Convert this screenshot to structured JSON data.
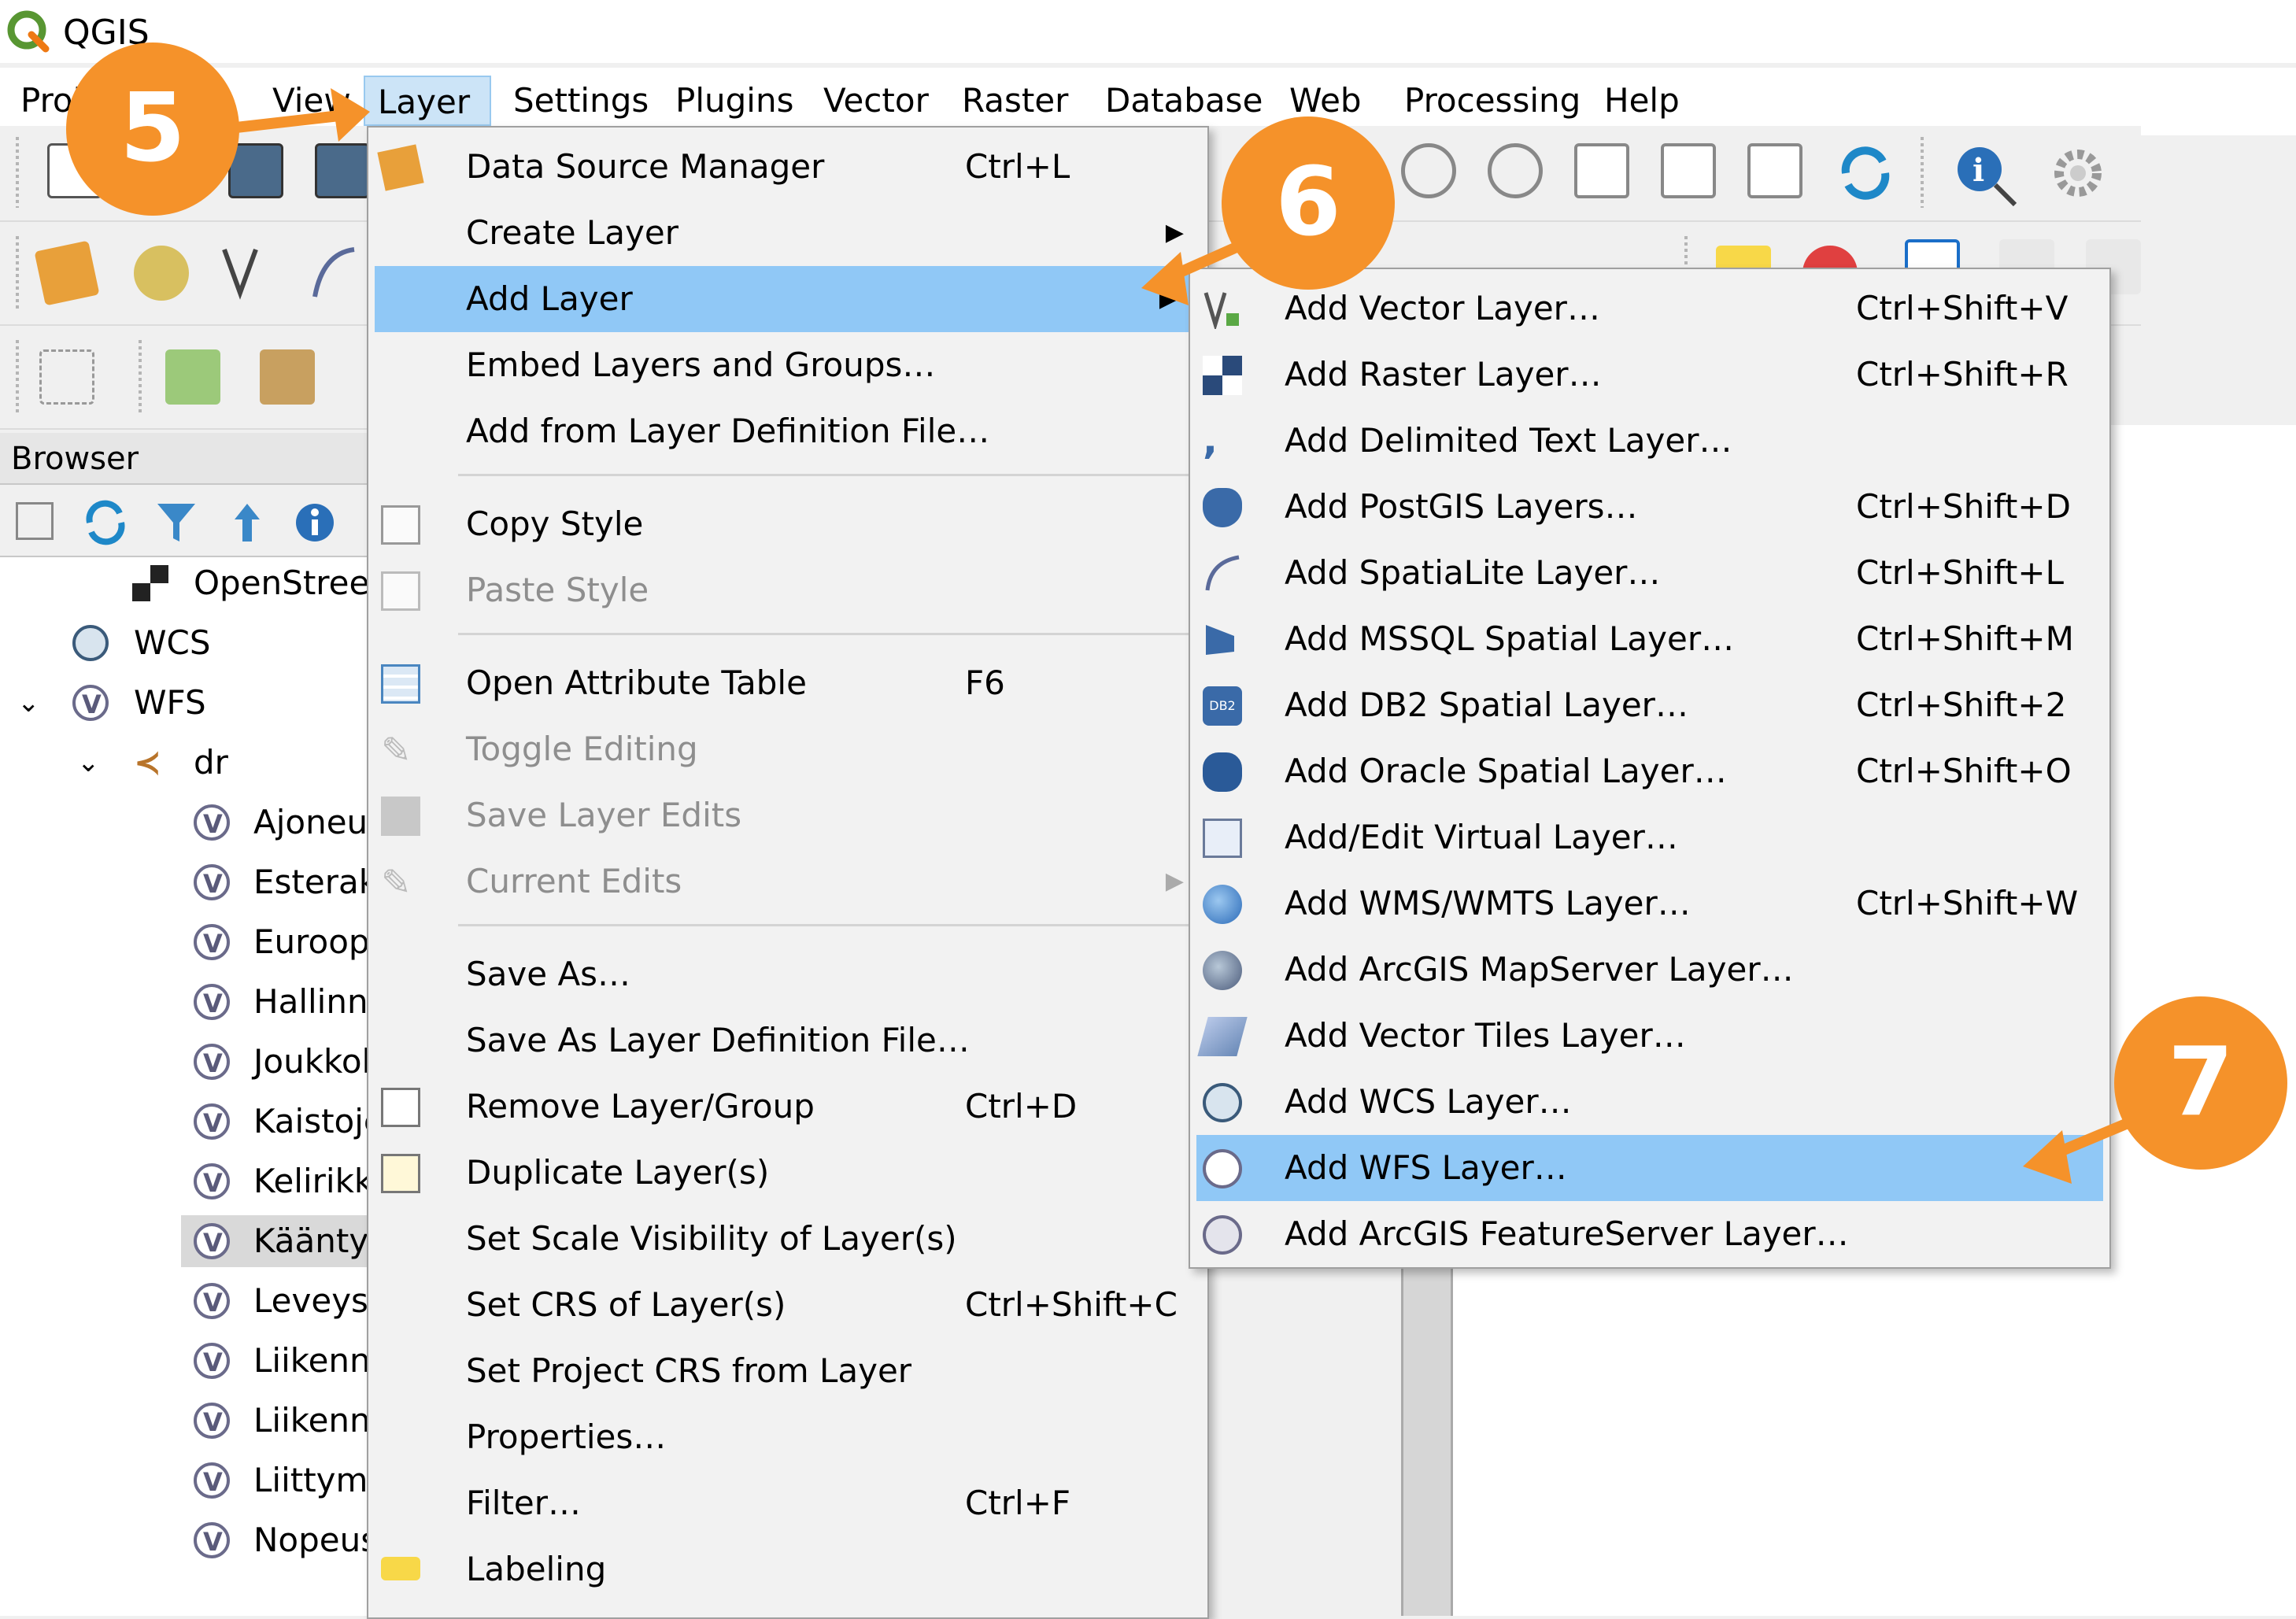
{
  "app": {
    "title": "QGIS"
  },
  "menubar": [
    {
      "label": "Proj"
    },
    {
      "label": "View"
    },
    {
      "label": "Layer"
    },
    {
      "label": "Settings"
    },
    {
      "label": "Plugins"
    },
    {
      "label": "Vector"
    },
    {
      "label": "Raster"
    },
    {
      "label": "Database"
    },
    {
      "label": "Web"
    },
    {
      "label": "Processing"
    },
    {
      "label": "Help"
    }
  ],
  "browser": {
    "title": "Browser",
    "items": [
      {
        "label": "OpenStreet"
      },
      {
        "label": "WCS"
      },
      {
        "label": "WFS"
      },
      {
        "label": "dr"
      },
      {
        "label": "Ajoneuv"
      },
      {
        "label": "Esterak"
      },
      {
        "label": "Euroop"
      },
      {
        "label": "Hallinno"
      },
      {
        "label": "Joukkoli"
      },
      {
        "label": "Kaistoje"
      },
      {
        "label": "Kelirikko"
      },
      {
        "label": "Kääntyr"
      },
      {
        "label": "Leveys"
      },
      {
        "label": "Liikenne"
      },
      {
        "label": "Liikenne"
      },
      {
        "label": "Liittymä"
      },
      {
        "label": "Nopeus"
      }
    ]
  },
  "layer_menu": {
    "items": [
      {
        "label": "Data Source Manager",
        "shortcut": "Ctrl+L"
      },
      {
        "label": "Create Layer",
        "shortcut": ""
      },
      {
        "label": "Add Layer",
        "shortcut": ""
      },
      {
        "label": "Embed Layers and Groups…",
        "shortcut": ""
      },
      {
        "label": "Add from Layer Definition File…",
        "shortcut": ""
      },
      {
        "label": "Copy Style",
        "shortcut": ""
      },
      {
        "label": "Paste Style",
        "shortcut": ""
      },
      {
        "label": "Open Attribute Table",
        "shortcut": "F6"
      },
      {
        "label": "Toggle Editing",
        "shortcut": ""
      },
      {
        "label": "Save Layer Edits",
        "shortcut": ""
      },
      {
        "label": "Current Edits",
        "shortcut": ""
      },
      {
        "label": "Save As…",
        "shortcut": ""
      },
      {
        "label": "Save As Layer Definition File…",
        "shortcut": ""
      },
      {
        "label": "Remove Layer/Group",
        "shortcut": "Ctrl+D"
      },
      {
        "label": "Duplicate Layer(s)",
        "shortcut": ""
      },
      {
        "label": "Set Scale Visibility of Layer(s)",
        "shortcut": ""
      },
      {
        "label": "Set CRS of Layer(s)",
        "shortcut": "Ctrl+Shift+C"
      },
      {
        "label": "Set Project CRS from Layer",
        "shortcut": ""
      },
      {
        "label": "Properties…",
        "shortcut": ""
      },
      {
        "label": "Filter…",
        "shortcut": "Ctrl+F"
      },
      {
        "label": "Labeling",
        "shortcut": ""
      }
    ]
  },
  "add_layer_menu": {
    "items": [
      {
        "label": "Add Vector Layer…",
        "shortcut": "Ctrl+Shift+V"
      },
      {
        "label": "Add Raster Layer…",
        "shortcut": "Ctrl+Shift+R"
      },
      {
        "label": "Add Delimited Text Layer…",
        "shortcut": ""
      },
      {
        "label": "Add PostGIS Layers…",
        "shortcut": "Ctrl+Shift+D"
      },
      {
        "label": "Add SpatiaLite Layer…",
        "shortcut": "Ctrl+Shift+L"
      },
      {
        "label": "Add MSSQL Spatial Layer…",
        "shortcut": "Ctrl+Shift+M"
      },
      {
        "label": "Add DB2 Spatial Layer…",
        "shortcut": "Ctrl+Shift+2"
      },
      {
        "label": "Add Oracle Spatial Layer…",
        "shortcut": "Ctrl+Shift+O"
      },
      {
        "label": "Add/Edit Virtual Layer…",
        "shortcut": ""
      },
      {
        "label": "Add WMS/WMTS Layer…",
        "shortcut": "Ctrl+Shift+W"
      },
      {
        "label": "Add ArcGIS MapServer Layer…",
        "shortcut": ""
      },
      {
        "label": "Add Vector Tiles Layer…",
        "shortcut": ""
      },
      {
        "label": "Add WCS Layer…",
        "shortcut": ""
      },
      {
        "label": "Add WFS Layer…",
        "shortcut": ""
      },
      {
        "label": "Add ArcGIS FeatureServer Layer…",
        "shortcut": ""
      }
    ],
    "db2_icon_text": "DB2"
  },
  "callouts": [
    {
      "label": "5"
    },
    {
      "label": "6"
    },
    {
      "label": "7"
    }
  ],
  "colors": {
    "highlight": "#90c8f6",
    "callout": "#f5922a",
    "menu_bg": "#f2f2f2"
  }
}
